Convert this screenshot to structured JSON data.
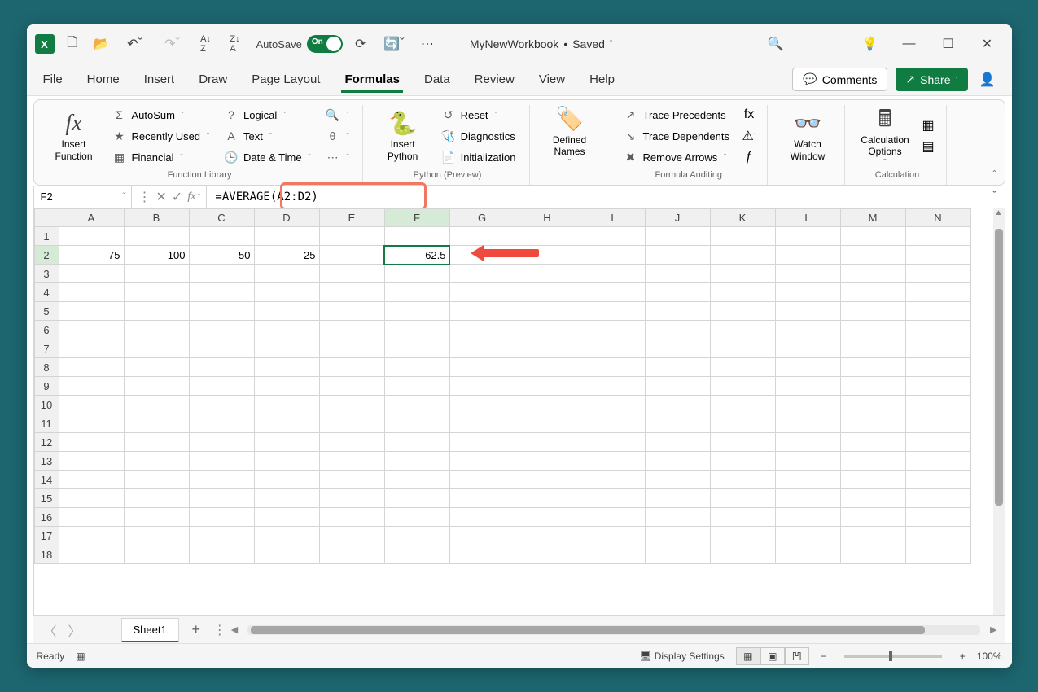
{
  "titlebar": {
    "autosave_label": "AutoSave",
    "autosave_state": "On",
    "doc_name": "MyNewWorkbook",
    "doc_status": "Saved"
  },
  "menu": {
    "items": [
      "File",
      "Home",
      "Insert",
      "Draw",
      "Page Layout",
      "Formulas",
      "Data",
      "Review",
      "View",
      "Help"
    ],
    "active": "Formulas",
    "comments": "Comments",
    "share": "Share"
  },
  "ribbon": {
    "insert_function": "Insert\nFunction",
    "function_library": {
      "label": "Function Library",
      "autosum": "AutoSum",
      "recently_used": "Recently Used",
      "financial": "Financial",
      "logical": "Logical",
      "text": "Text",
      "date_time": "Date & Time"
    },
    "python": {
      "label": "Python (Preview)",
      "insert_python": "Insert\nPython",
      "reset": "Reset",
      "diagnostics": "Diagnostics",
      "initialization": "Initialization"
    },
    "defined_names": "Defined\nNames",
    "formula_auditing": {
      "label": "Formula Auditing",
      "trace_precedents": "Trace Precedents",
      "trace_dependents": "Trace Dependents",
      "remove_arrows": "Remove Arrows"
    },
    "watch_window": "Watch\nWindow",
    "calculation": {
      "label": "Calculation",
      "options": "Calculation\nOptions"
    }
  },
  "formula_bar": {
    "name_box": "F2",
    "formula": "=AVERAGE(A2:D2)"
  },
  "grid": {
    "columns": [
      "A",
      "B",
      "C",
      "D",
      "E",
      "F",
      "G",
      "H",
      "I",
      "J",
      "K",
      "L",
      "M",
      "N"
    ],
    "rows": 18,
    "active_col": "F",
    "active_row": 2,
    "cells": {
      "A2": "75",
      "B2": "100",
      "C2": "50",
      "D2": "25",
      "F2": "62.5"
    },
    "selected": "F2"
  },
  "sheet_tabs": {
    "active": "Sheet1"
  },
  "statusbar": {
    "ready": "Ready",
    "display_settings": "Display Settings",
    "zoom": "100%"
  }
}
